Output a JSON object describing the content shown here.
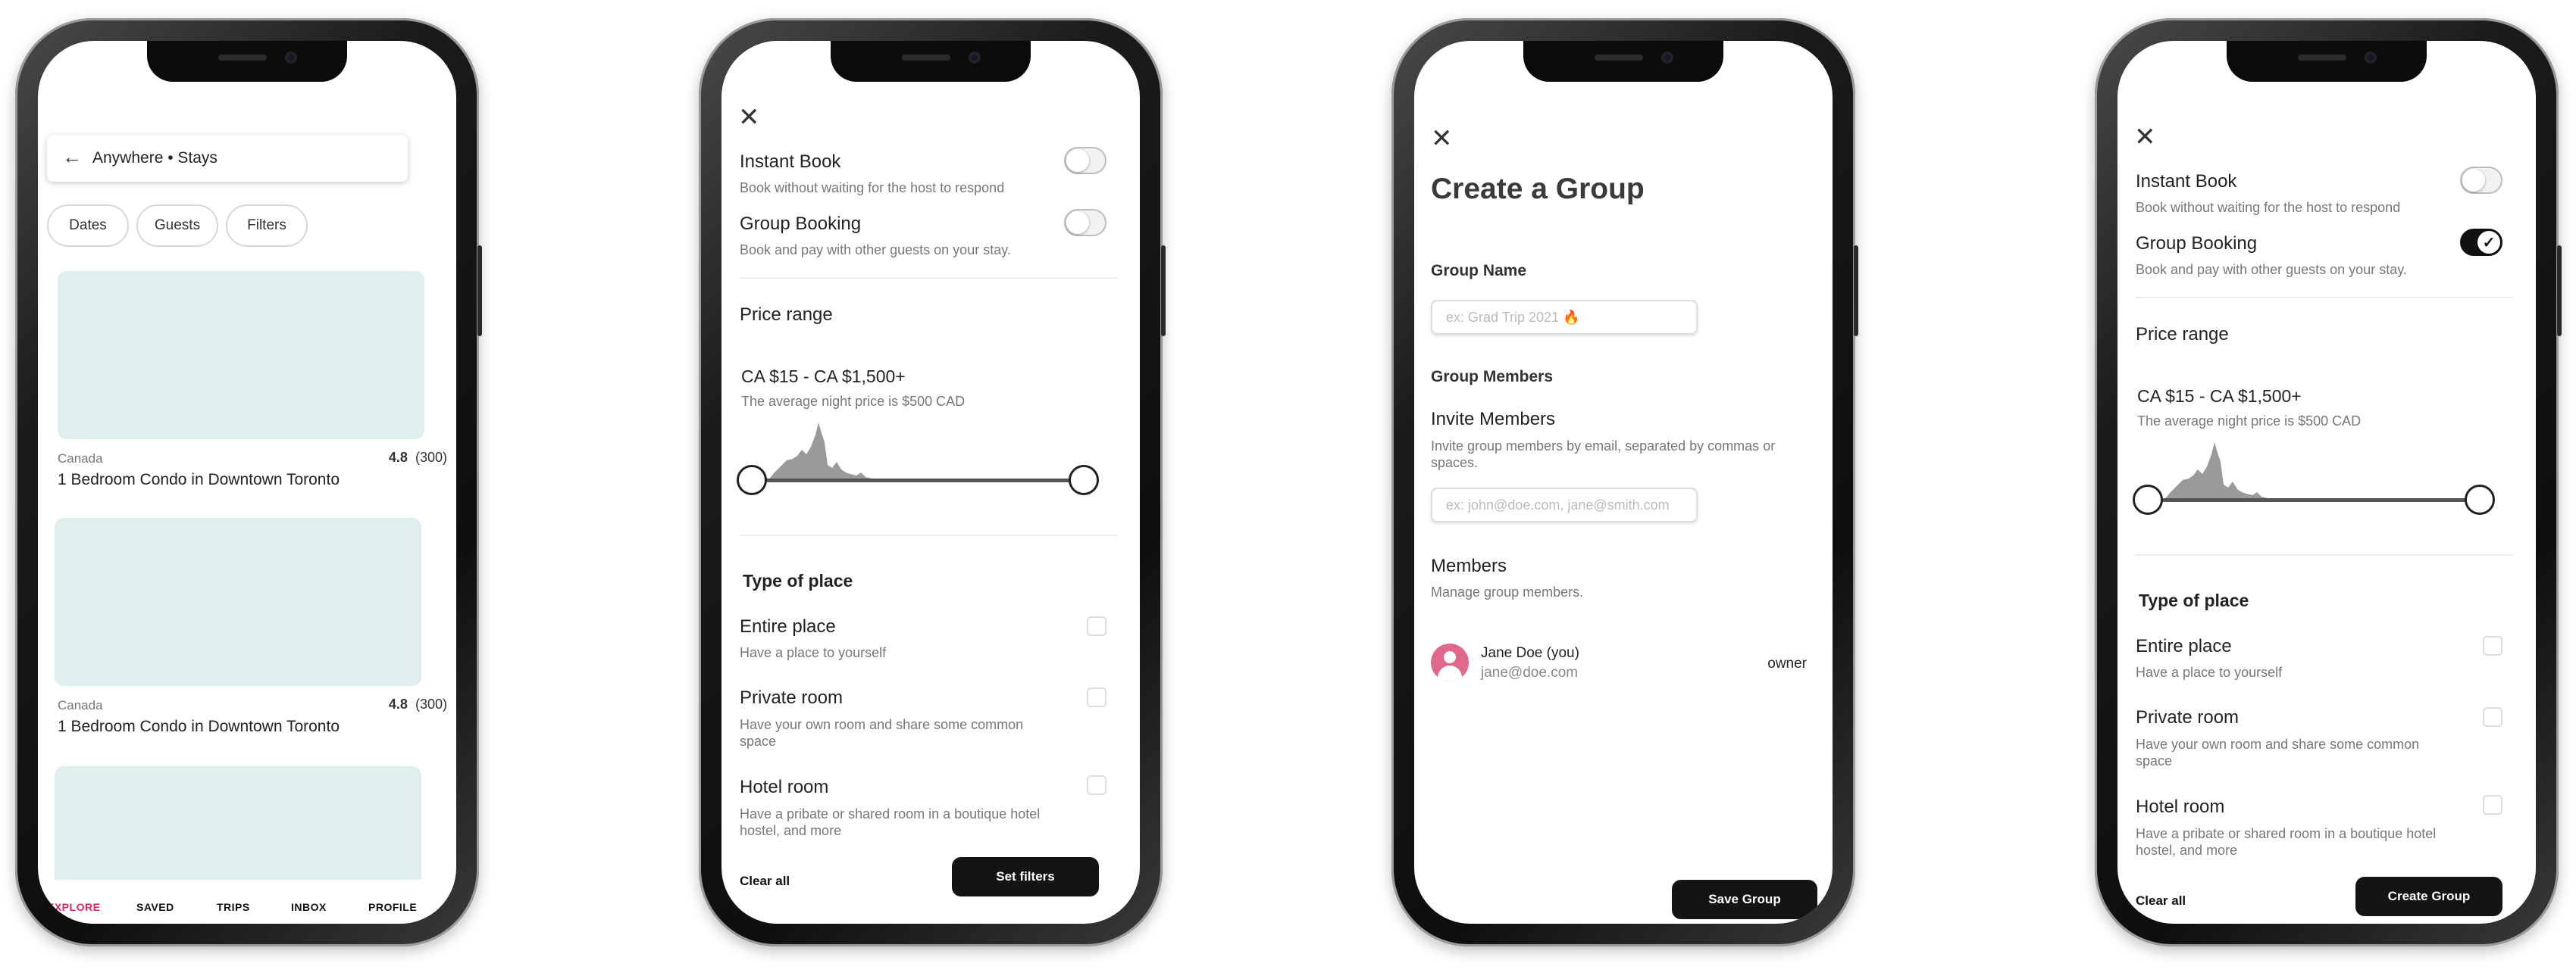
{
  "screen1": {
    "search_title": "Anywhere • Stays",
    "chips": [
      "Dates",
      "Guests",
      "Filters"
    ],
    "listings": [
      {
        "location": "Canada",
        "rating": "4.8",
        "reviews": "(300)",
        "title": "1 Bedroom Condo in Downtown Toronto"
      },
      {
        "location": "Canada",
        "rating": "4.8",
        "reviews": "(300)",
        "title": "1 Bedroom Condo in Downtown Toronto"
      }
    ],
    "tabs": [
      "EXPLORE",
      "SAVED",
      "TRIPS",
      "INBOX",
      "PROFILE"
    ],
    "active_tab_color": "#e0245e"
  },
  "filters": {
    "instant_book": {
      "label": "Instant Book",
      "desc": "Book without waiting for the host to respond"
    },
    "group_booking": {
      "label": "Group Booking",
      "desc": "Book and pay with other guests on your stay."
    },
    "price": {
      "heading": "Price range",
      "range": "CA $15 - CA $1,500+",
      "avg": "The average night price is $500 CAD"
    },
    "type_heading": "Type of place",
    "places": [
      {
        "label": "Entire place",
        "desc": "Have a place to yourself"
      },
      {
        "label": "Private room",
        "desc": "Have your own room and share some common space"
      },
      {
        "label": "Hotel room",
        "desc": "Have a pribate or shared room in a boutique hotel hostel, and more"
      }
    ],
    "clear_all": "Clear all"
  },
  "screen2": {
    "group_booking_on": false,
    "action_label": "Set filters"
  },
  "screen3": {
    "title": "Create a Group",
    "group_name_label": "Group Name",
    "group_name_placeholder": "ex: Grad Trip 2021 🔥",
    "group_members_label": "Group Members",
    "invite_label": "Invite Members",
    "invite_desc": "Invite group members by email, separated by commas or spaces.",
    "invite_placeholder": "ex: john@doe.com, jane@smith.com",
    "members_label": "Members",
    "members_desc": "Manage group members.",
    "member": {
      "name": "Jane Doe (you)",
      "email": "jane@doe.com",
      "role": "owner"
    },
    "save_label": "Save Group"
  },
  "screen4": {
    "group_booking_on": true,
    "action_label": "Create Group"
  }
}
